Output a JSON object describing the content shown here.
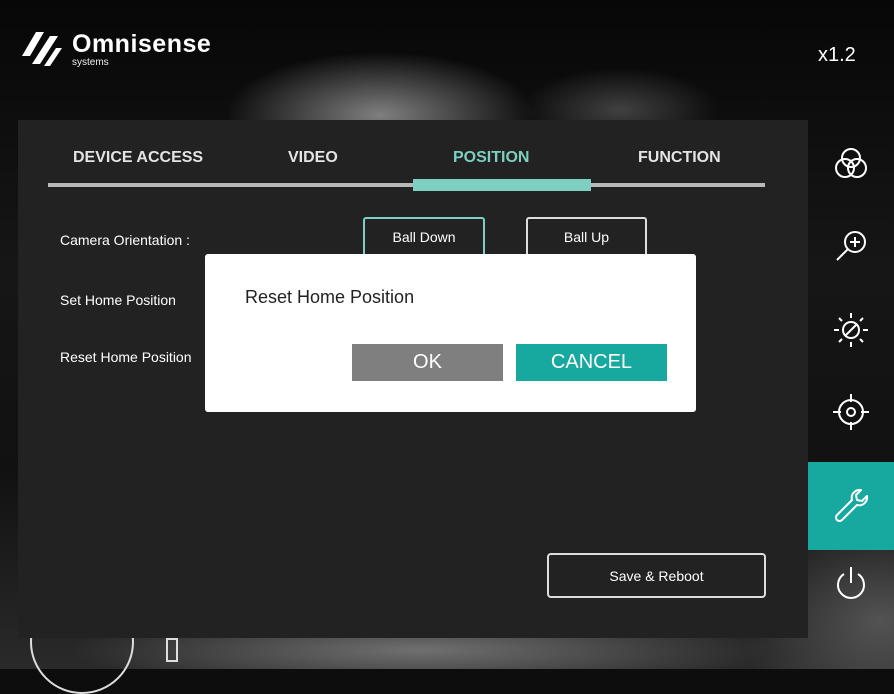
{
  "header": {
    "brand_name": "Omnisense",
    "brand_sub": "systems",
    "zoom_level": "x1.2"
  },
  "tabs": [
    {
      "label": "DEVICE ACCESS",
      "active": false
    },
    {
      "label": "VIDEO",
      "active": false
    },
    {
      "label": "POSITION",
      "active": true
    },
    {
      "label": "FUNCTION",
      "active": false
    }
  ],
  "position": {
    "orientation_label": "Camera Orientation :",
    "ball_down_label": "Ball Down",
    "ball_up_label": "Ball Up",
    "selected_orientation": "Ball Down",
    "set_home_label": "Set Home Position",
    "reset_home_label": "Reset Home Position",
    "save_reboot_label": "Save & Reboot"
  },
  "sidebar": {
    "items": [
      {
        "icon": "color-circles-icon",
        "active": false
      },
      {
        "icon": "zoom-in-icon",
        "active": false
      },
      {
        "icon": "brightness-icon",
        "active": false
      },
      {
        "icon": "crosshair-icon",
        "active": false
      },
      {
        "icon": "wrench-icon",
        "active": true
      },
      {
        "icon": "power-icon",
        "active": false
      }
    ]
  },
  "dialog": {
    "title": "Reset Home Position",
    "ok_label": "OK",
    "cancel_label": "CANCEL"
  },
  "colors": {
    "accent": "#7dcfc2",
    "accent_dark": "#17a8a0",
    "panel": "#222222"
  }
}
